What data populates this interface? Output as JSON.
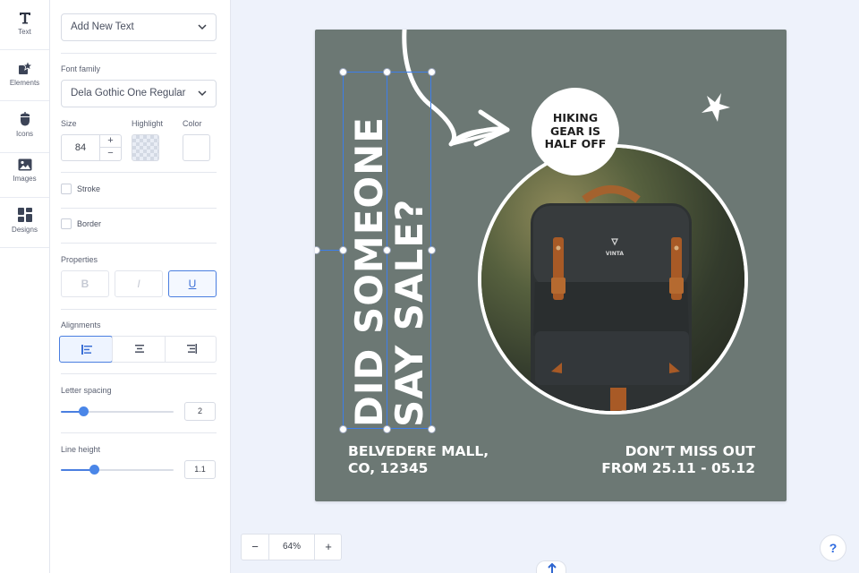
{
  "sidebar": {
    "items": [
      {
        "label": "Text",
        "icon": "text-icon"
      },
      {
        "label": "Elements",
        "icon": "elements-icon"
      },
      {
        "label": "Icons",
        "icon": "icons-icon"
      },
      {
        "label": "Images",
        "icon": "images-icon"
      },
      {
        "label": "Designs",
        "icon": "designs-icon"
      }
    ]
  },
  "panel": {
    "add_text": "Add New Text",
    "font_family_label": "Font family",
    "font_family_value": "Dela Gothic One Regular",
    "size_label": "Size",
    "size_value": "84",
    "size_inc": "+",
    "size_dec": "−",
    "highlight_label": "Highlight",
    "color_label": "Color",
    "stroke_label": "Stroke",
    "border_label": "Border",
    "properties_label": "Properties",
    "bold": "B",
    "italic": "I",
    "underline": "U",
    "alignments_label": "Alignments",
    "letter_spacing_label": "Letter spacing",
    "letter_spacing_value": "2",
    "letter_spacing_fraction": 0.2,
    "line_height_label": "Line height",
    "line_height_value": "1.1",
    "line_height_fraction": 0.29
  },
  "canvas": {
    "headline_line1": "DID SOMEONE",
    "headline_line2": "SAY SALE?",
    "badge_line1": "HIKING",
    "badge_line2": "GEAR IS",
    "badge_line3": "HALF OFF",
    "address_line1": "BELVEDERE MALL,",
    "address_line2": "CO, 12345",
    "promo_line1": "DON’T MISS OUT",
    "promo_line2": "FROM 25.11 - 05.12",
    "background_color": "#6c7874",
    "backpack_logo": "VINTA"
  },
  "zoom": {
    "minus": "−",
    "value": "64%",
    "plus": "+"
  },
  "help_label": "?",
  "colors": {
    "accent": "#4a7ee0",
    "selection": "#3d7eea"
  }
}
